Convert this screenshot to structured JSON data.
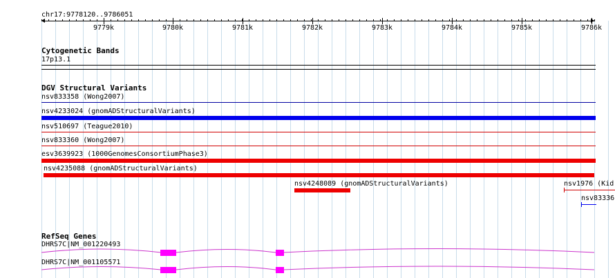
{
  "ruler": {
    "location": "chr17:9778120..9786051",
    "ticks": [
      "9779k",
      "9780k",
      "9781k",
      "9782k",
      "9783k",
      "9784k",
      "9785k",
      "9786k"
    ]
  },
  "cytobands": {
    "title": "Cytogenetic Bands",
    "band": "17p13.1"
  },
  "dgv": {
    "title": "DGV Structural Variants",
    "features": [
      {
        "label": "nsv833358 (Wong2007)",
        "color": "#0000a0",
        "style": "line"
      },
      {
        "label": "nsv4233024 (gnomADStructuralVariants)",
        "color": "#0000ee",
        "style": "thick"
      },
      {
        "label": "nsv510697 (Teague2010)",
        "color": "#d00000",
        "style": "line"
      },
      {
        "label": "nsv833360 (Wong2007)",
        "color": "#d00000",
        "style": "line"
      },
      {
        "label": "esv3639923 (1000GenomesConsortiumPhase3)",
        "color": "#ee0000",
        "style": "thick"
      },
      {
        "label": "nsv4235088 (gnomADStructuralVariants)",
        "color": "#ee0000",
        "style": "thick"
      },
      {
        "label": "nsv4248089 (gnomADStructuralVariants)",
        "color": "#ee0000",
        "style": "thick"
      },
      {
        "label": "nsv1976 (Kid",
        "color": "#d00000",
        "style": "line"
      },
      {
        "label": "nsv83336",
        "color": "#0000ee",
        "style": "line"
      }
    ]
  },
  "refseq": {
    "title": "RefSeq Genes",
    "transcripts": [
      {
        "label": "DHRS7C|NM_001220493",
        "color": "#cc33cc",
        "exon_color": "#ff00ff"
      },
      {
        "label": "DHRS7C|NM_001105571",
        "color": "#cc33cc",
        "exon_color": "#ff00ff"
      }
    ]
  },
  "colors": {
    "grid": "#c8dcea",
    "ruler": "#000000",
    "band_line": "#000000"
  }
}
